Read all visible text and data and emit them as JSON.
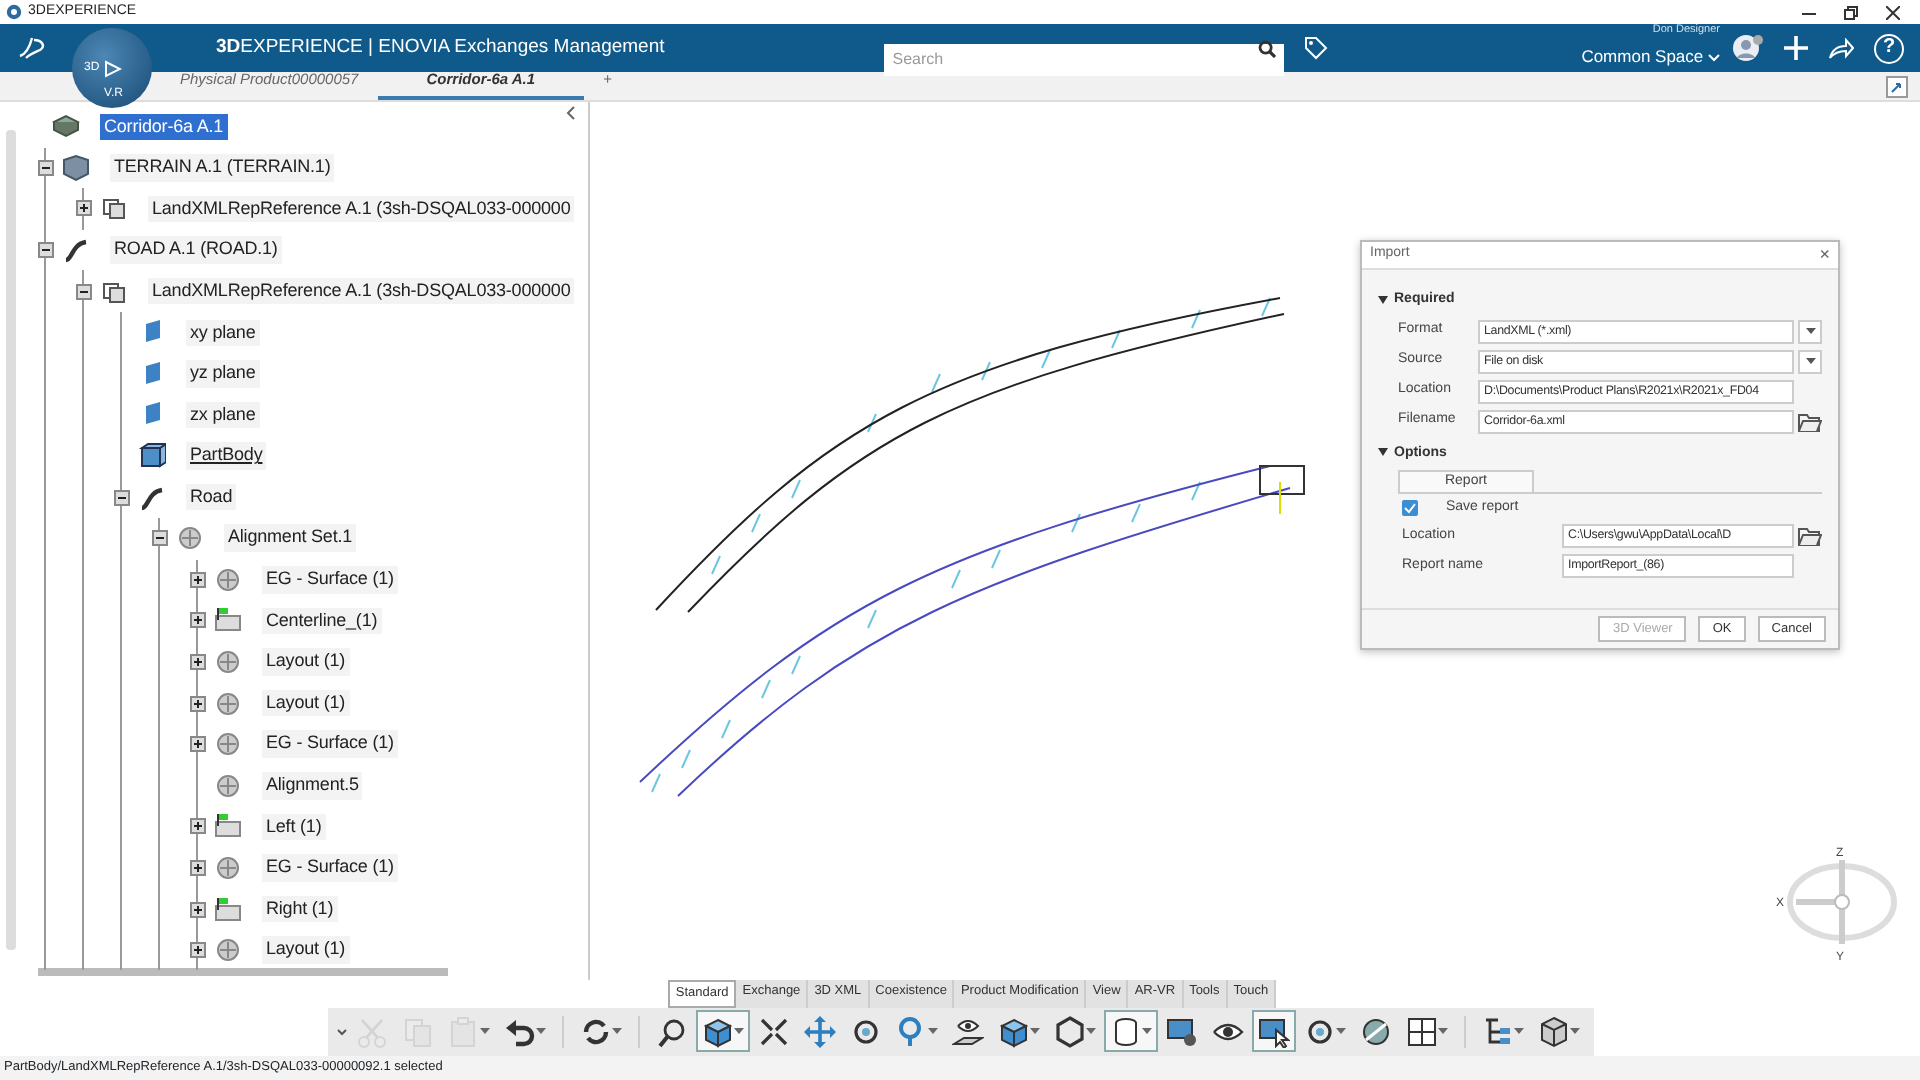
{
  "window": {
    "title": "3DEXPERIENCE"
  },
  "header": {
    "brand": "**3D**EXPERIENCE | ENOVIA Exchanges Management",
    "compass_labels": [
      "3D",
      "V.R"
    ],
    "search": {
      "placeholder": "Search"
    },
    "user": "Don Designer",
    "space": "Common Space",
    "help": "?"
  },
  "doc_tabs": [
    {
      "label": "Physical Product00000057",
      "selected": false
    },
    {
      "label": "Corridor-6a A.1",
      "selected": true
    }
  ],
  "add_tab": "+",
  "tree": {
    "label": "Corridor-6a A.1",
    "kind": "product",
    "selected": true,
    "children": [
      {
        "label": "TERRAIN A.1 (TERRAIN.1)",
        "kind": "terrain",
        "expanded": true,
        "selected": false,
        "children": [
          {
            "label": "LandXMLRepReference A.1 (3sh-DSQAL033-000000",
            "kind": "rep",
            "expanded": false,
            "selected": false
          }
        ]
      },
      {
        "label": "ROAD A.1 (ROAD.1)",
        "kind": "road",
        "expanded": true,
        "selected": false,
        "children": [
          {
            "label": "LandXMLRepReference A.1 (3sh-DSQAL033-000000",
            "kind": "rep",
            "expanded": true,
            "selected": false,
            "children": [
              {
                "label": "xy plane",
                "kind": "plane",
                "selected": false
              },
              {
                "label": "yz plane",
                "kind": "plane",
                "selected": false
              },
              {
                "label": "zx plane",
                "kind": "plane",
                "selected": false
              },
              {
                "label": "PartBody",
                "kind": "body",
                "selected": false
              },
              {
                "label": "Road",
                "kind": "road",
                "expanded": true,
                "selected": false,
                "children": [
                  {
                    "label": "Alignment Set.1",
                    "kind": "alignment",
                    "expanded": true,
                    "selected": false,
                    "children": [
                      {
                        "label": "EG - Surface (1)",
                        "kind": "alignment",
                        "expanded": false,
                        "selected": false
                      },
                      {
                        "label": "Centerline_(1)",
                        "kind": "flagged",
                        "expanded": false,
                        "selected": false
                      },
                      {
                        "label": "Layout (1)",
                        "kind": "alignment",
                        "expanded": false,
                        "selected": false
                      },
                      {
                        "label": "Layout (1)",
                        "kind": "alignment",
                        "expanded": false,
                        "selected": false
                      },
                      {
                        "label": "EG - Surface (1)",
                        "kind": "alignment",
                        "expanded": false,
                        "selected": false
                      },
                      {
                        "label": "Alignment.5",
                        "kind": "alignment",
                        "selected": false
                      },
                      {
                        "label": "Left (1)",
                        "kind": "flagged",
                        "expanded": false,
                        "selected": false
                      },
                      {
                        "label": "EG - Surface (1)",
                        "kind": "alignment",
                        "expanded": false,
                        "selected": false
                      },
                      {
                        "label": "Right (1)",
                        "kind": "flagged",
                        "expanded": false,
                        "selected": false
                      },
                      {
                        "label": "Layout (1)",
                        "kind": "alignment",
                        "expanded": false,
                        "selected": false
                      }
                    ]
                  }
                ]
              }
            ]
          }
        ]
      }
    ]
  },
  "dialog": {
    "title": "Import",
    "close": "×",
    "sections": [
      {
        "title": "Required",
        "expanded": true,
        "fields": [
          {
            "label": "Format",
            "value": "LandXML (*.xml)",
            "kind": "select"
          },
          {
            "label": "Source",
            "value": "File on disk",
            "kind": "select"
          },
          {
            "label": "Location",
            "value": "D:\\Documents\\Product Plans\\R2021x\\R2021x_FD04",
            "kind": "text"
          },
          {
            "label": "Filename",
            "value": "Corridor-6a.xml",
            "kind": "file"
          }
        ]
      },
      {
        "title": "Options",
        "expanded": true,
        "tab": "Report",
        "checkbox": {
          "label": "Save report",
          "checked": true
        },
        "fields": [
          {
            "label": "Location",
            "value": "C:\\Users\\gwu\\AppData\\Local\\D",
            "kind": "file"
          },
          {
            "label": "Report name",
            "value": "ImportReport_(86)",
            "kind": "text"
          }
        ]
      }
    ],
    "buttons": [
      {
        "label": "3D Viewer",
        "disabled": true
      },
      {
        "label": "OK",
        "disabled": false
      },
      {
        "label": "Cancel",
        "disabled": false
      }
    ]
  },
  "compass_axes": [
    "Z",
    "X",
    "Y"
  ],
  "toolbar_tabs": [
    {
      "label": "Standard",
      "selected": true
    },
    {
      "label": "Exchange",
      "selected": false
    },
    {
      "label": "3D XML",
      "selected": false
    },
    {
      "label": "Coexistence",
      "selected": false
    },
    {
      "label": "Product Modification",
      "selected": false
    },
    {
      "label": "View",
      "selected": false
    },
    {
      "label": "AR-VR",
      "selected": false
    },
    {
      "label": "Tools",
      "selected": false
    },
    {
      "label": "Touch",
      "selected": false
    }
  ],
  "tools": [
    {
      "kind": "scissors",
      "disabled": true,
      "pressed": false,
      "dropdown": false
    },
    {
      "kind": "copy",
      "disabled": true,
      "pressed": false,
      "dropdown": false
    },
    {
      "kind": "paste",
      "disabled": true,
      "pressed": false,
      "dropdown": true
    },
    {
      "kind": "undo",
      "disabled": false,
      "pressed": false,
      "dropdown": true
    },
    {
      "kind": "cycle",
      "disabled": false,
      "pressed": false,
      "dropdown": true
    },
    {
      "kind": "zoomfit",
      "disabled": false,
      "pressed": false,
      "dropdown": false
    },
    {
      "kind": "cube",
      "disabled": false,
      "pressed": true,
      "dropdown": true
    },
    {
      "kind": "shrink",
      "disabled": false,
      "pressed": false,
      "dropdown": false
    },
    {
      "kind": "pan",
      "disabled": false,
      "pressed": false,
      "dropdown": false
    },
    {
      "kind": "rotate",
      "disabled": false,
      "pressed": false,
      "dropdown": false
    },
    {
      "kind": "zoom",
      "disabled": false,
      "pressed": false,
      "dropdown": true
    },
    {
      "kind": "eyeplane",
      "disabled": false,
      "pressed": false,
      "dropdown": false
    },
    {
      "kind": "cube",
      "disabled": false,
      "pressed": false,
      "dropdown": true
    },
    {
      "kind": "hexagon",
      "disabled": false,
      "pressed": false,
      "dropdown": true
    },
    {
      "kind": "cylinder",
      "disabled": false,
      "pressed": true,
      "dropdown": true
    },
    {
      "kind": "screengear",
      "disabled": false,
      "pressed": false,
      "dropdown": false
    },
    {
      "kind": "eye",
      "disabled": false,
      "pressed": false,
      "dropdown": false
    },
    {
      "kind": "cursor",
      "disabled": false,
      "pressed": true,
      "dropdown": false
    },
    {
      "kind": "rotate",
      "disabled": false,
      "pressed": false,
      "dropdown": true
    },
    {
      "kind": "globe",
      "disabled": false,
      "pressed": false,
      "dropdown": false
    },
    {
      "kind": "grid",
      "disabled": false,
      "pressed": false,
      "dropdown": true
    },
    {
      "kind": "tree",
      "disabled": false,
      "pressed": false,
      "dropdown": true
    },
    {
      "kind": "box",
      "disabled": false,
      "pressed": false,
      "dropdown": true
    }
  ],
  "status_bar": "PartBody/LandXMLRepReference A.1/3sh-DSQAL033-00000092.1 selected"
}
